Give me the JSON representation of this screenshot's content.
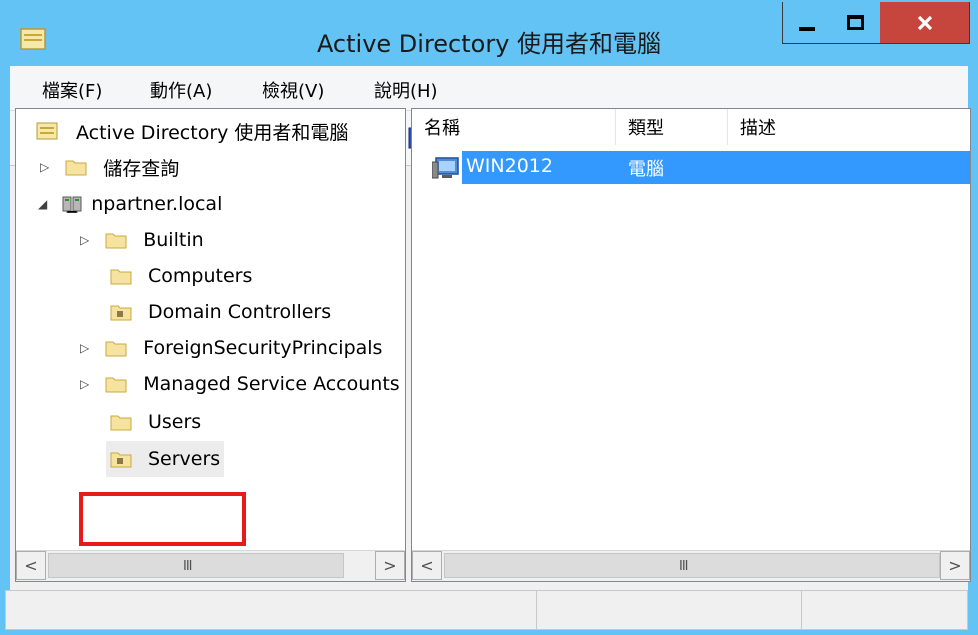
{
  "window": {
    "title": "Active Directory 使用者和電腦"
  },
  "menu": {
    "items": [
      "檔案(F)",
      "動作(A)",
      "檢視(V)",
      "說明(H)"
    ]
  },
  "toolbar": {
    "icons": [
      "back-arrow-icon",
      "forward-arrow-icon",
      "up-folder-icon",
      "show-console-tree-icon",
      "cut-icon",
      "copy-icon",
      "delete-icon",
      "properties-icon",
      "refresh-icon",
      "export-list-icon",
      "help-icon",
      "show-action-pane-icon",
      "new-user-icon",
      "new-group-icon",
      "new-ou-icon",
      "filter-icon",
      "find-icon",
      "add-to-group-icon"
    ]
  },
  "tree": {
    "root": "Active Directory 使用者和電腦",
    "saved_queries": "儲存查詢",
    "domain": "npartner.local",
    "items": [
      "Builtin",
      "Computers",
      "Domain Controllers",
      "ForeignSecurityPrincipals",
      "Managed Service Accounts",
      "Users",
      "Servers"
    ],
    "selected": "Servers"
  },
  "list": {
    "columns": [
      "名稱",
      "類型",
      "描述"
    ],
    "rows": [
      {
        "name": "WIN2012",
        "type": "電腦",
        "description": ""
      }
    ]
  },
  "scrollbar": {
    "grip": "III"
  },
  "colors": {
    "titlebar": "#64c3f5",
    "close": "#c6463d",
    "selection": "#3399ff",
    "highlight_box": "#e81a1a"
  }
}
